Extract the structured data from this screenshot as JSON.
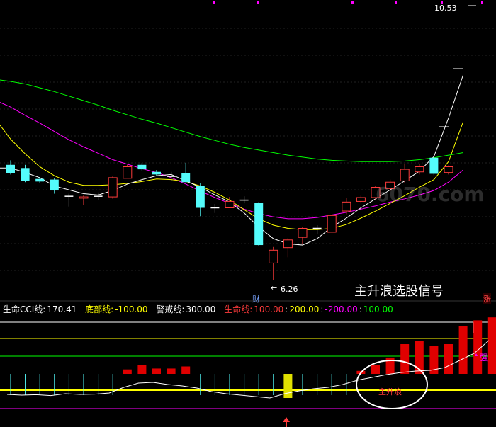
{
  "top_label": "10.53",
  "low_label": "6.26",
  "marker_label": "财",
  "watermark": "6070.com",
  "signal_title": "主升浪选股信号",
  "corner_tag": "涨",
  "indicator": {
    "name": "生命CCI线:",
    "value": "170.41",
    "bottom_label": "底部线:",
    "bottom_value": "-100.00",
    "warning_label": "警戒线:",
    "warning_value": "300.00",
    "life_label": "生命线:",
    "life_value1": "100.00",
    "life_value2": "200.00",
    "life_value3": "-200.00",
    "life_value4": "100.00",
    "sep": ":"
  },
  "strong_label": "强",
  "wave_label": "主升浪",
  "colors": {
    "up": "#ff3b3b",
    "down": "#54fcfc",
    "ma5": "#ffffff",
    "ma10": "#ffff00",
    "ma20": "#ff00ff",
    "ma60": "#00ff00",
    "bar_red": "#e00000",
    "bar_yellow": "#e0e000"
  },
  "chart_data": [
    {
      "type": "candlestick",
      "title": "",
      "candles": [
        {
          "o": 8.05,
          "h": 8.12,
          "l": 7.9,
          "c": 7.92,
          "dir": "down"
        },
        {
          "o": 8.0,
          "h": 8.05,
          "l": 7.78,
          "c": 7.8,
          "dir": "down"
        },
        {
          "o": 7.83,
          "h": 7.86,
          "l": 7.77,
          "c": 7.79,
          "dir": "down"
        },
        {
          "o": 7.82,
          "h": 7.84,
          "l": 7.6,
          "c": 7.65,
          "dir": "down"
        },
        {
          "o": 7.55,
          "h": 7.6,
          "l": 7.4,
          "c": 7.56,
          "dir": "doji"
        },
        {
          "o": 7.53,
          "h": 7.57,
          "l": 7.42,
          "c": 7.55,
          "dir": "up"
        },
        {
          "o": 7.55,
          "h": 7.62,
          "l": 7.5,
          "c": 7.56,
          "dir": "doji"
        },
        {
          "o": 7.55,
          "h": 7.88,
          "l": 7.52,
          "c": 7.85,
          "dir": "up"
        },
        {
          "o": 7.84,
          "h": 8.05,
          "l": 7.84,
          "c": 8.02,
          "dir": "up"
        },
        {
          "o": 8.05,
          "h": 8.08,
          "l": 7.96,
          "c": 7.98,
          "dir": "down"
        },
        {
          "o": 7.94,
          "h": 7.97,
          "l": 7.88,
          "c": 7.9,
          "dir": "down"
        },
        {
          "o": 7.87,
          "h": 7.94,
          "l": 7.8,
          "c": 7.86,
          "dir": "doji"
        },
        {
          "o": 7.92,
          "h": 8.08,
          "l": 7.78,
          "c": 7.78,
          "dir": "down"
        },
        {
          "o": 7.72,
          "h": 7.76,
          "l": 7.25,
          "c": 7.38,
          "dir": "down"
        },
        {
          "o": 7.38,
          "h": 7.44,
          "l": 7.3,
          "c": 7.37,
          "dir": "doji"
        },
        {
          "o": 7.38,
          "h": 7.55,
          "l": 7.38,
          "c": 7.48,
          "dir": "up"
        },
        {
          "o": 7.5,
          "h": 7.56,
          "l": 7.45,
          "c": 7.48,
          "dir": "doji"
        },
        {
          "o": 7.46,
          "h": 7.47,
          "l": 6.78,
          "c": 6.8,
          "dir": "down"
        },
        {
          "o": 6.52,
          "h": 6.77,
          "l": 6.26,
          "c": 6.72,
          "dir": "up"
        },
        {
          "o": 6.76,
          "h": 6.91,
          "l": 6.61,
          "c": 6.88,
          "dir": "up"
        },
        {
          "o": 6.92,
          "h": 7.08,
          "l": 6.82,
          "c": 7.06,
          "dir": "up"
        },
        {
          "o": 7.06,
          "h": 7.11,
          "l": 6.97,
          "c": 7.05,
          "dir": "doji"
        },
        {
          "o": 7.0,
          "h": 7.26,
          "l": 7.0,
          "c": 7.26,
          "dir": "up"
        },
        {
          "o": 7.33,
          "h": 7.53,
          "l": 7.28,
          "c": 7.47,
          "dir": "up"
        },
        {
          "o": 7.48,
          "h": 7.57,
          "l": 7.45,
          "c": 7.54,
          "dir": "up"
        },
        {
          "o": 7.54,
          "h": 7.72,
          "l": 7.51,
          "c": 7.7,
          "dir": "up"
        },
        {
          "o": 7.68,
          "h": 7.82,
          "l": 7.64,
          "c": 7.78,
          "dir": "up"
        },
        {
          "o": 7.8,
          "h": 8.06,
          "l": 7.76,
          "c": 7.98,
          "dir": "up"
        },
        {
          "o": 7.94,
          "h": 8.07,
          "l": 7.9,
          "c": 8.02,
          "dir": "up"
        },
        {
          "o": 8.16,
          "h": 8.17,
          "l": 7.89,
          "c": 7.91,
          "dir": "down"
        },
        {
          "o": 7.93,
          "h": 8.04,
          "l": 7.9,
          "c": 8.02,
          "dir": "up"
        }
      ],
      "ma5": [
        8.0,
        8.0,
        7.93,
        7.85,
        7.72,
        7.66,
        7.6,
        7.58,
        7.65,
        7.75,
        7.82,
        7.88,
        7.9,
        7.8,
        7.7,
        7.58,
        7.47,
        7.3,
        7.08,
        6.9,
        6.82,
        6.8,
        6.9,
        7.08,
        7.22,
        7.38,
        7.52,
        7.66,
        7.8,
        7.95,
        8.18,
        8.78,
        9.45
      ],
      "ma10": [
        8.75,
        8.45,
        8.22,
        8.02,
        7.88,
        7.78,
        7.73,
        7.73,
        7.74,
        7.76,
        7.79,
        7.83,
        7.82,
        7.79,
        7.72,
        7.62,
        7.5,
        7.35,
        7.21,
        7.11,
        7.06,
        7.04,
        7.04,
        7.06,
        7.12,
        7.22,
        7.33,
        7.45,
        7.57,
        7.7,
        7.82,
        8.1,
        8.72
      ],
      "ma20": [
        9.05,
        8.95,
        8.82,
        8.7,
        8.57,
        8.44,
        8.33,
        8.23,
        8.13,
        8.06,
        7.99,
        7.93,
        7.85,
        7.75,
        7.64,
        7.54,
        7.45,
        7.36,
        7.29,
        7.24,
        7.21,
        7.21,
        7.23,
        7.27,
        7.31,
        7.36,
        7.41,
        7.47,
        7.52,
        7.58,
        7.65,
        7.78,
        7.97
      ],
      "ma60": [
        9.38,
        9.35,
        9.31,
        9.25,
        9.19,
        9.12,
        9.05,
        8.98,
        8.9,
        8.83,
        8.76,
        8.7,
        8.63,
        8.56,
        8.49,
        8.43,
        8.37,
        8.32,
        8.28,
        8.24,
        8.2,
        8.17,
        8.14,
        8.12,
        8.11,
        8.1,
        8.1,
        8.1,
        8.11,
        8.13,
        8.16,
        8.2,
        8.24
      ],
      "annotations": [
        {
          "text": "10.53",
          "price": 10.53
        },
        {
          "text": "6.26",
          "price": 6.26
        }
      ]
    },
    {
      "type": "bar",
      "title": "生命CCI线",
      "reference_lines": [
        {
          "name": "警戒线",
          "value": 300
        },
        {
          "name": "生命线",
          "value": 200
        },
        {
          "name": "生命线",
          "value": 100
        },
        {
          "name": "底部线",
          "value": -100
        },
        {
          "name": "生命线",
          "value": -200
        }
      ],
      "bars": [
        {
          "v": 0,
          "c": "line"
        },
        {
          "v": 0,
          "c": "line"
        },
        {
          "v": 0,
          "c": "line"
        },
        {
          "v": 0,
          "c": "line"
        },
        {
          "v": 0,
          "c": "line"
        },
        {
          "v": 0,
          "c": "line"
        },
        {
          "v": 0,
          "c": "line"
        },
        {
          "v": 0,
          "c": "line"
        },
        {
          "v": 15,
          "c": "red"
        },
        {
          "v": 30,
          "c": "red"
        },
        {
          "v": 18,
          "c": "red"
        },
        {
          "v": 18,
          "c": "red"
        },
        {
          "v": 25,
          "c": "red"
        },
        {
          "v": 0,
          "c": "line"
        },
        {
          "v": 0,
          "c": "line"
        },
        {
          "v": 0,
          "c": "line"
        },
        {
          "v": 0,
          "c": "line"
        },
        {
          "v": 0,
          "c": "line"
        },
        {
          "v": 0,
          "c": "line"
        },
        {
          "v": 0,
          "c": "yellow"
        },
        {
          "v": 0,
          "c": "line"
        },
        {
          "v": 0,
          "c": "line"
        },
        {
          "v": 0,
          "c": "line"
        },
        {
          "v": 0,
          "c": "line"
        },
        {
          "v": 10,
          "c": "red"
        },
        {
          "v": 30,
          "c": "red"
        },
        {
          "v": 55,
          "c": "red"
        },
        {
          "v": 100,
          "c": "red"
        },
        {
          "v": 110,
          "c": "red"
        },
        {
          "v": 95,
          "c": "red"
        },
        {
          "v": 100,
          "c": "red"
        },
        {
          "v": 160,
          "c": "red"
        },
        {
          "v": 180,
          "c": "red"
        },
        {
          "v": 190,
          "c": "red"
        }
      ],
      "cci_line": [
        -210,
        -215,
        -212,
        -218,
        -205,
        -210,
        -208,
        -200,
        -160,
        -130,
        -125,
        -140,
        -150,
        -165,
        -190,
        -205,
        -215,
        -225,
        -235,
        -205,
        -185,
        -170,
        -160,
        -140,
        -110,
        -90,
        -70,
        -55,
        -45,
        -40,
        -20,
        30,
        80,
        170.41
      ]
    }
  ]
}
